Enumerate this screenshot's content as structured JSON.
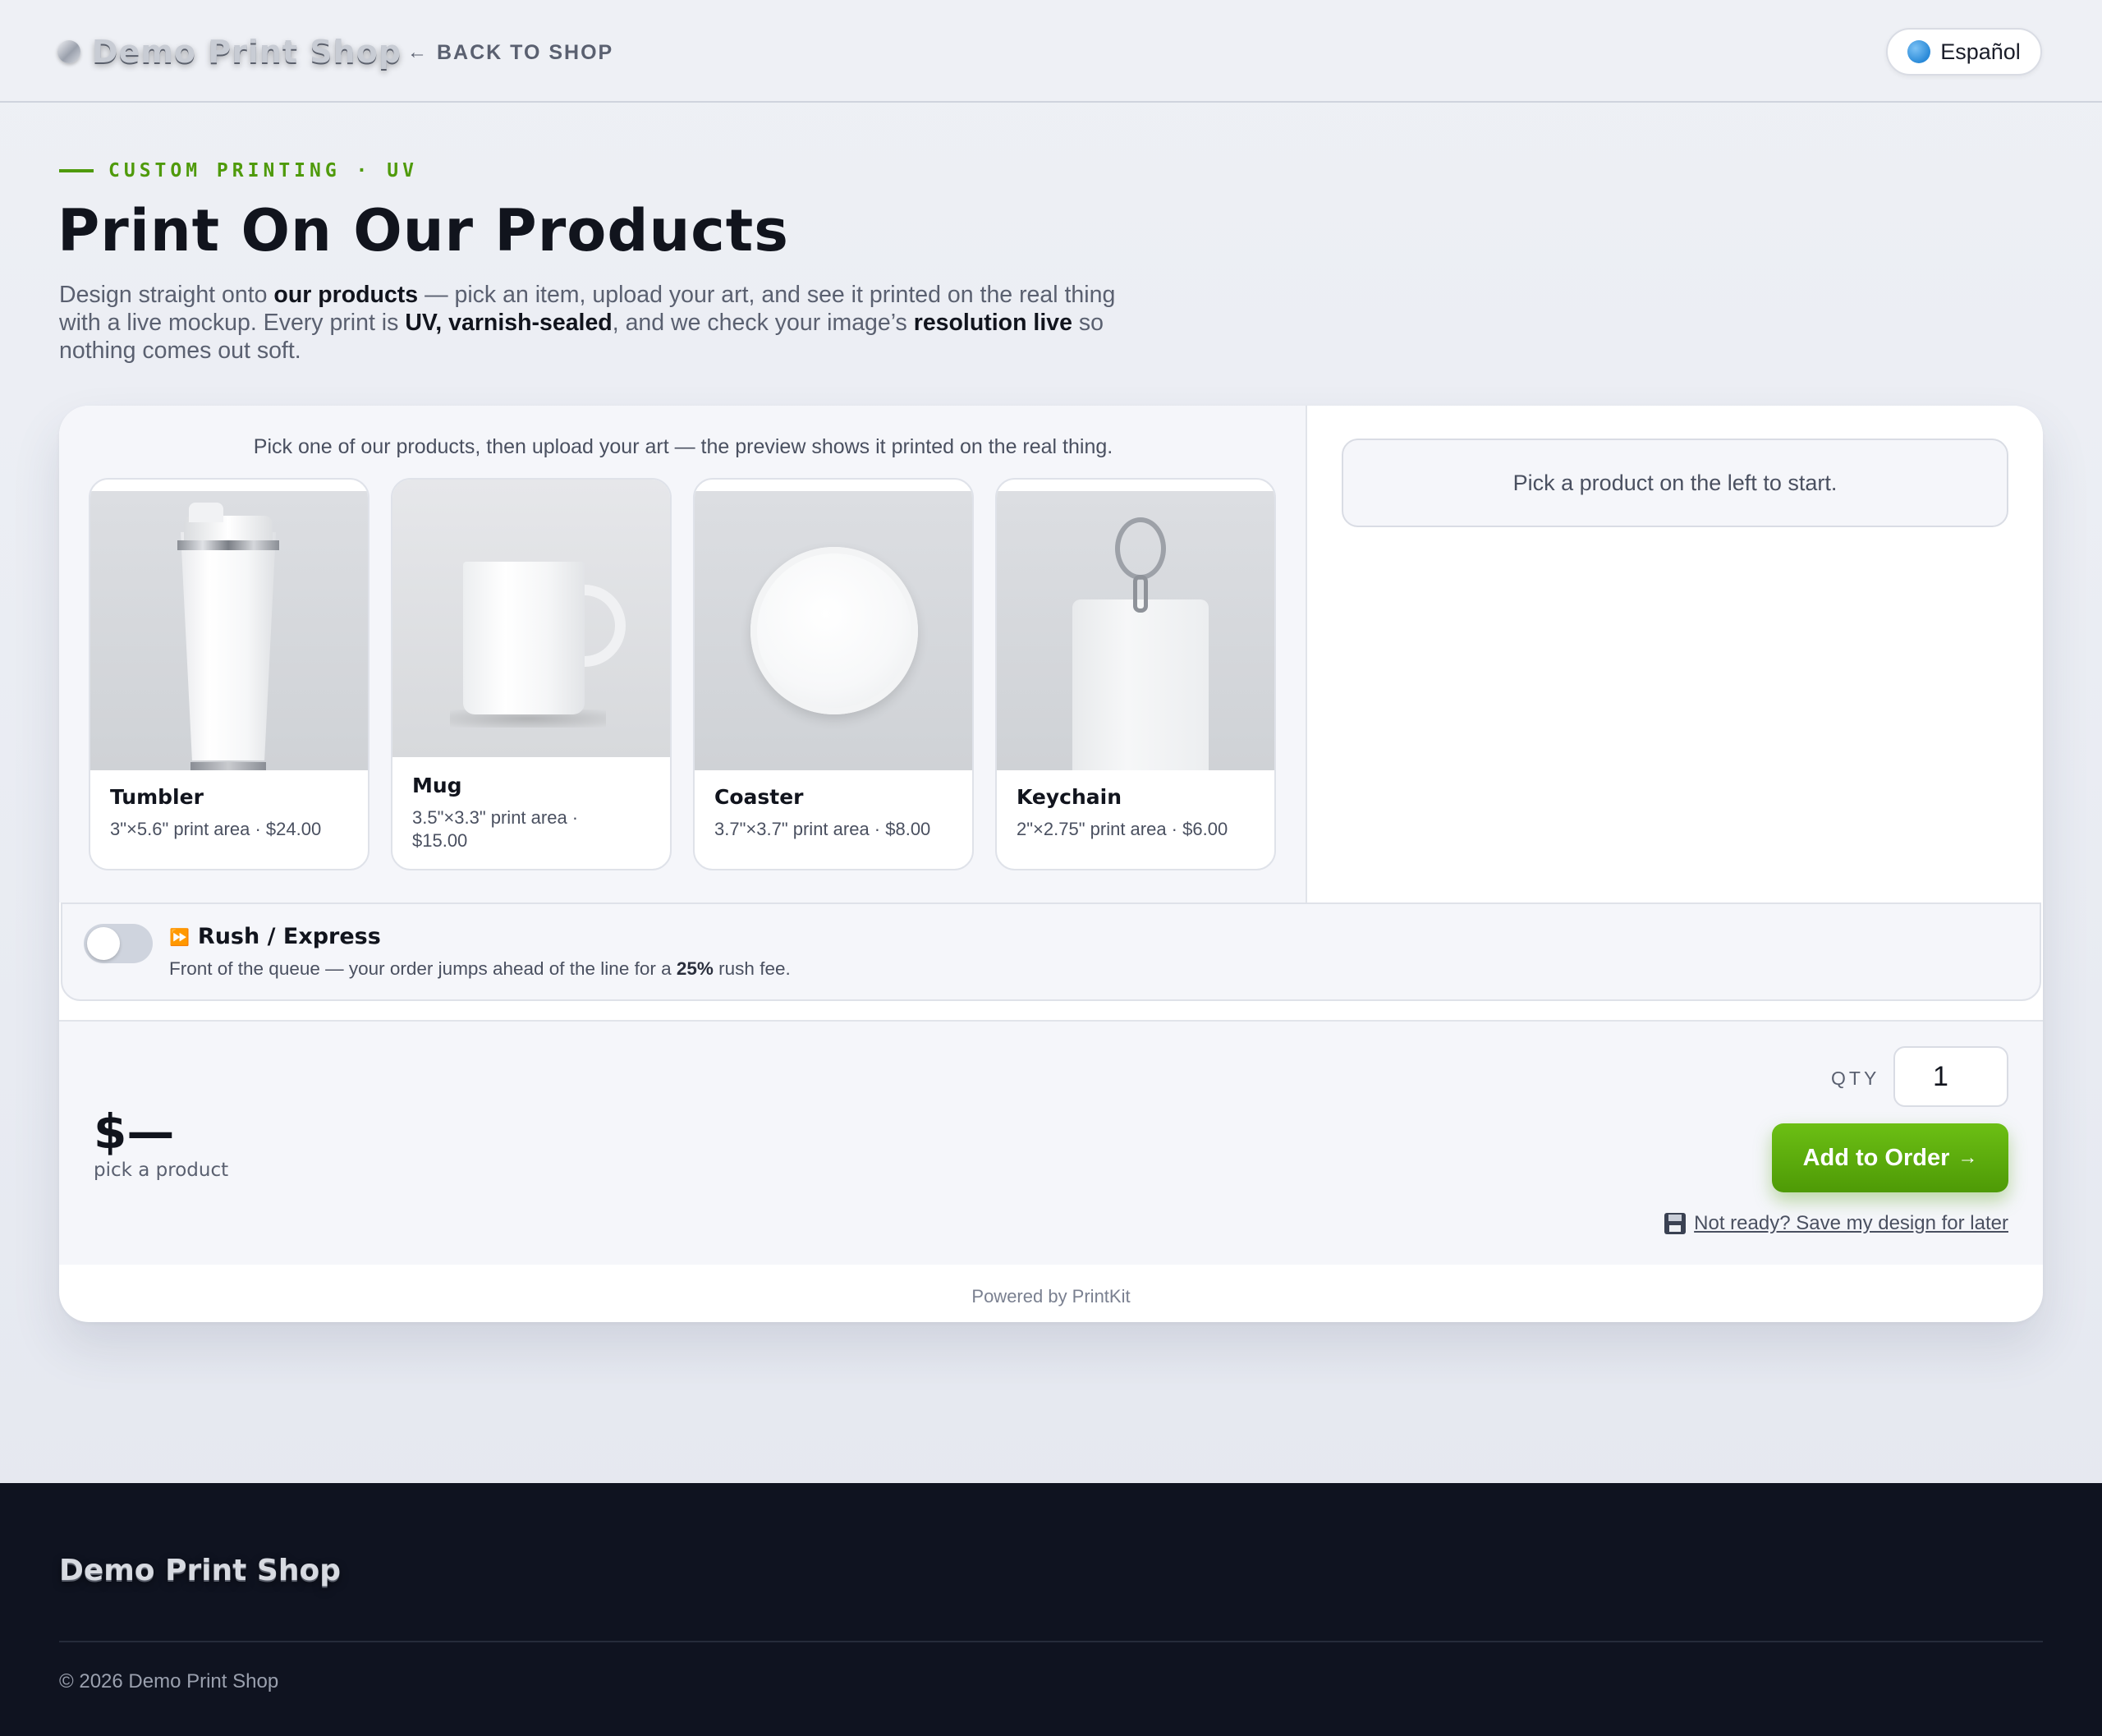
{
  "header": {
    "logo_text": "Demo Print Shop",
    "back_arrow": "←",
    "back_label": "BACK TO SHOP",
    "language_label": "Español"
  },
  "hero": {
    "eyebrow": "CUSTOM PRINTING · UV",
    "title": "Print On Our Products",
    "desc_1": "Design straight onto ",
    "desc_b1": "our products",
    "desc_2": " — pick an item, upload your art, and see it printed on the real thing with a live mockup. Every print is ",
    "desc_b2": "UV, varnish-sealed",
    "desc_3": ", and we check your image’s ",
    "desc_b3": "resolution live",
    "desc_4": " so nothing comes out soft."
  },
  "picker": {
    "hint": "Pick one of our products, then upload your art — the preview shows it printed on the real thing.",
    "products": [
      {
        "name": "Tumbler",
        "meta": "3\"×5.6\" print area · $24.00"
      },
      {
        "name": "Mug",
        "meta": "3.5\"×3.3\" print area · $15.00"
      },
      {
        "name": "Coaster",
        "meta": "3.7\"×3.7\" print area · $8.00"
      },
      {
        "name": "Keychain",
        "meta": "2\"×2.75\" print area · $6.00"
      }
    ]
  },
  "preview": {
    "start_message": "Pick a product on the left to start."
  },
  "rush": {
    "icon": "⏩",
    "title": "Rush / Express",
    "desc_1": "Front of the queue — your order jumps ahead of the line for a ",
    "desc_b": "25%",
    "desc_2": " rush fee.",
    "enabled": false
  },
  "order": {
    "price": "$—",
    "price_sub": "pick a product",
    "qty_label": "QTY",
    "qty_value": "1",
    "add_label": "Add to Order",
    "add_arrow": "→",
    "save_label": "Not ready? Save my design for later",
    "powered_by": "Powered by PrintKit"
  },
  "footer": {
    "logo_text": "Demo Print Shop",
    "copyright": "© 2026 Demo Print Shop"
  },
  "colors": {
    "accent_green": "#4f9a0b",
    "footer_bg": "#0f1320"
  }
}
